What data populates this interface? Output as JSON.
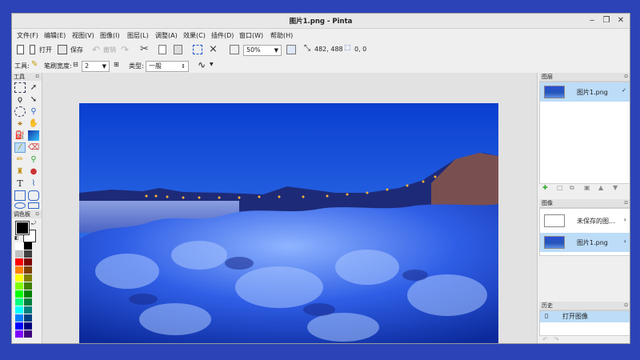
{
  "window": {
    "title": "图片1.png - Pinta"
  },
  "menu": [
    "文件(F)",
    "编辑(E)",
    "视图(V)",
    "图像(I)",
    "图层(L)",
    "调整(A)",
    "效果(C)",
    "插件(D)",
    "窗口(W)",
    "帮助(H)"
  ],
  "toolbar": {
    "open_label": "打开",
    "save_label": "保存",
    "undo_label": "撤销",
    "zoom_value": "50%",
    "image_size": "482, 488",
    "selection_size": "0, 0"
  },
  "options": {
    "tool_label": "工具:",
    "brush_width_label": "笔刷宽度:",
    "brush_width_value": "2",
    "type_label": "类型:",
    "type_value": "一般"
  },
  "panels": {
    "tools_title": "工具",
    "palette_title": "调色板",
    "layers_title": "图层",
    "images_title": "图像",
    "history_title": "历史"
  },
  "layers": [
    {
      "name": "图片1.png"
    }
  ],
  "images": [
    {
      "name": "未保存的图..."
    },
    {
      "name": "图片1.png"
    }
  ],
  "history": [
    {
      "name": "打开图像"
    }
  ],
  "palette_colors": [
    "#ffffff",
    "#000000",
    "#c0c0c0",
    "#404040",
    "#ff0000",
    "#800000",
    "#ff8000",
    "#804000",
    "#ffff00",
    "#808000",
    "#80ff00",
    "#408000",
    "#00ff00",
    "#008000",
    "#00ff80",
    "#008040",
    "#00ffff",
    "#008080",
    "#0080ff",
    "#004080",
    "#0000ff",
    "#000080",
    "#8000ff",
    "#400080"
  ],
  "colors": {
    "accent": "#bcdcf8",
    "bg": "#2b43b6"
  }
}
